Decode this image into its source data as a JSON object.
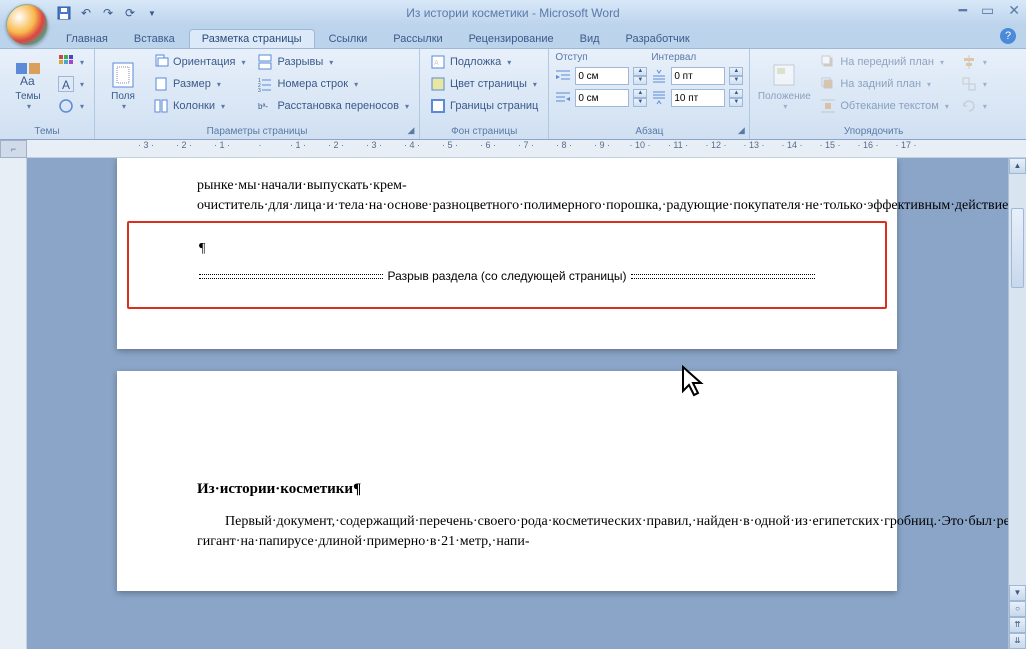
{
  "title": "Из истории косметики - Microsoft Word",
  "tabs": [
    "Главная",
    "Вставка",
    "Разметка страницы",
    "Ссылки",
    "Рассылки",
    "Рецензирование",
    "Вид",
    "Разработчик"
  ],
  "active_tab": 2,
  "groups": {
    "themes": {
      "label": "Темы",
      "themes_btn": "Темы"
    },
    "page_setup": {
      "label": "Параметры страницы",
      "margins": "Поля",
      "orientation": "Ориентация",
      "size": "Размер",
      "columns": "Колонки",
      "breaks": "Разрывы",
      "line_numbers": "Номера строк",
      "hyphenation": "Расстановка переносов"
    },
    "page_bg": {
      "label": "Фон страницы",
      "watermark": "Подложка",
      "page_color": "Цвет страницы",
      "page_borders": "Границы страниц"
    },
    "paragraph": {
      "label": "Абзац",
      "indent_label": "Отступ",
      "spacing_label": "Интервал",
      "indent_left": "0 см",
      "indent_right": "0 см",
      "space_before": "0 пт",
      "space_after": "10 пт"
    },
    "arrange": {
      "label": "Упорядочить",
      "position": "Положение",
      "bring_front": "На передний план",
      "send_back": "На задний план",
      "text_wrap": "Обтекание текстом"
    }
  },
  "ruler": [
    "3",
    "2",
    "1",
    "",
    "1",
    "2",
    "3",
    "4",
    "5",
    "6",
    "7",
    "8",
    "9",
    "10",
    "11",
    "12",
    "13",
    "14",
    "15",
    "16",
    "17"
  ],
  "doc": {
    "p1": "рынке·мы·начали·выпускать·крем-очиститель·для·лица·и·тела·на·основе·разноцветного·полимерного·порошка,·радующие·покупателя·не·только·эффективным·действием,·но·и·оригинальным·внешним·видом.·Подбирая·цвет,·запах·и·упаковку·для·своих·изделий,·мы·стараемся,·чтобы·они·не·только·выполняли·свое·непосредственное·назначение,·но·и·поднимали·настроение,·доставляли·удовольствие·потребителю.¶",
    "break": "Разрыв раздела (со следующей страницы)",
    "heading": "Из·истории·косметики¶",
    "p2": "Первый·документ,·содержащий·перечень·своего·рода·косметических·правил,·найден·в·одной·из·египетских·гробниц.·Это·был·рецепт-гигант·на·папирусе·длиной·примерно·в·21·метр,·напи-"
  }
}
